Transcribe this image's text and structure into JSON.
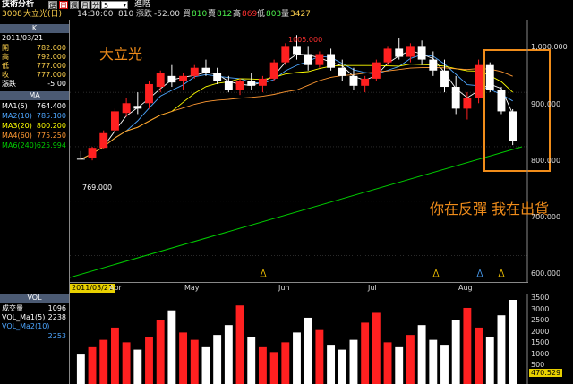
{
  "app": {
    "title": "技術分析",
    "buttons": [
      "選",
      "日",
      "週",
      "月",
      "分"
    ],
    "period_value": "5",
    "advanced_label": "進階"
  },
  "quote": {
    "code": "3008",
    "name": "大立光(日)",
    "time": "14:30:00",
    "volume": "810",
    "change_label": "漲跌",
    "change": "-52.00",
    "bid_label": "買",
    "bid": "810",
    "ask_label": "賣",
    "ask": "812",
    "high_label": "高",
    "high": "869",
    "low_label": "低",
    "low": "803",
    "vol_label": "量",
    "vol": "3427"
  },
  "panel": {
    "k_header": "K",
    "date": "2011/03/21",
    "ohlc": [
      {
        "label": "開",
        "value": "782.000"
      },
      {
        "label": "高",
        "value": "792.000"
      },
      {
        "label": "低",
        "value": "777.000"
      },
      {
        "label": "收",
        "value": "777.000"
      },
      {
        "label": "漲跌",
        "value": "-5.00"
      }
    ],
    "ma_header": "MA",
    "ma": [
      {
        "label": "MA1(5)",
        "value": "764.400",
        "color": "#ffffff"
      },
      {
        "label": "MA2(10)",
        "value": "785.100",
        "color": "#4da6ff"
      },
      {
        "label": "MA3(20)",
        "value": "800.200",
        "color": "#ffff00"
      },
      {
        "label": "MA4(60)",
        "value": "775.250",
        "color": "#ff9933"
      },
      {
        "label": "MA6(240)",
        "value": "625.994",
        "color": "#00cc00"
      }
    ],
    "vol_header": "VOL",
    "vol_rows": [
      {
        "label": "成交量",
        "value": "1096",
        "color": "#ffffff"
      },
      {
        "label": "VOL_Ma1(5)",
        "value": "2238",
        "color": "#ffffff"
      },
      {
        "label": "VOL_Ma2(10)",
        "value": "",
        "color": "#4da6ff"
      },
      {
        "label": "",
        "value": "2253",
        "color": "#4da6ff"
      }
    ]
  },
  "chart_labels": {
    "stock_name": "大立光",
    "slogan": "你在反彈 我在出貨",
    "high_marker": "1005.000",
    "low_marker": "769.000",
    "date_tag": "2011/03/21",
    "months": [
      "Apr",
      "May",
      "Jun",
      "Jul",
      "Aug"
    ],
    "price_ticks": [
      "1,000.000",
      "900.000",
      "800.000",
      "700.000",
      "600.000"
    ],
    "vol_ticks": [
      "3500",
      "3000",
      "2500",
      "2000",
      "1500",
      "1000",
      "500"
    ],
    "vol_current": "470.529"
  },
  "colors": {
    "up": "#ff2020",
    "down": "#ffffff",
    "highlight_box": "#f08c1a",
    "grid": "#555555"
  },
  "chart_data": {
    "type": "candlestick",
    "x_period": [
      "2011/03/21",
      "2011/08"
    ],
    "price_range": [
      560,
      1030
    ],
    "candles_sample": [
      [
        778,
        792,
        777,
        777
      ],
      [
        780,
        800,
        775,
        798
      ],
      [
        798,
        830,
        795,
        825
      ],
      [
        830,
        870,
        825,
        865
      ],
      [
        862,
        890,
        855,
        880
      ],
      [
        875,
        900,
        860,
        870
      ],
      [
        880,
        920,
        870,
        915
      ],
      [
        910,
        940,
        900,
        935
      ],
      [
        930,
        950,
        910,
        918
      ],
      [
        920,
        935,
        905,
        930
      ],
      [
        930,
        950,
        925,
        945
      ],
      [
        945,
        960,
        930,
        935
      ],
      [
        935,
        945,
        915,
        920
      ],
      [
        920,
        930,
        900,
        905
      ],
      [
        905,
        925,
        895,
        920
      ],
      [
        920,
        935,
        905,
        912
      ],
      [
        912,
        930,
        900,
        925
      ],
      [
        925,
        960,
        920,
        955
      ],
      [
        955,
        990,
        950,
        985
      ],
      [
        985,
        1005,
        960,
        970
      ],
      [
        970,
        985,
        940,
        950
      ],
      [
        950,
        975,
        945,
        970
      ],
      [
        970,
        980,
        940,
        945
      ],
      [
        945,
        960,
        920,
        930
      ],
      [
        930,
        945,
        905,
        912
      ],
      [
        912,
        930,
        900,
        925
      ],
      [
        925,
        960,
        920,
        955
      ],
      [
        955,
        985,
        950,
        980
      ],
      [
        980,
        1000,
        960,
        965
      ],
      [
        965,
        990,
        955,
        985
      ],
      [
        985,
        995,
        950,
        960
      ],
      [
        960,
        975,
        930,
        940
      ],
      [
        940,
        960,
        900,
        910
      ],
      [
        910,
        930,
        860,
        870
      ],
      [
        870,
        900,
        850,
        890
      ],
      [
        890,
        960,
        880,
        950
      ],
      [
        950,
        955,
        900,
        905
      ],
      [
        905,
        910,
        860,
        865
      ],
      [
        865,
        869,
        803,
        810
      ]
    ],
    "ma240_range": [
      560,
      800
    ],
    "volume_sample": [
      1200,
      1500,
      1800,
      2300,
      1700,
      1400,
      1900,
      2600,
      3000,
      2100,
      1800,
      1500,
      2000,
      2400,
      3200,
      1900,
      1500,
      1300,
      1700,
      2100,
      2700,
      2200,
      1600,
      1400,
      1800,
      2500,
      2900,
      1700,
      1500,
      2000,
      2400,
      1800,
      1600,
      2600,
      3100,
      2300,
      1900,
      2800,
      3427
    ]
  }
}
